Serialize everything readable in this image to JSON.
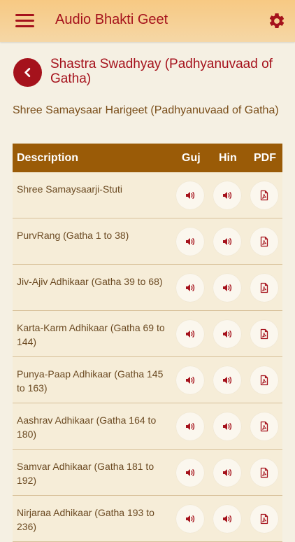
{
  "app": {
    "title": "Audio Bhakti Geet"
  },
  "page": {
    "title": "Shastra Swadhyay (Padhyanuvaad of Gatha)",
    "subtitle": "Shree Samaysaar Harigeet (Padhyanuvaad of Gatha)"
  },
  "table": {
    "headers": {
      "description": "Description",
      "guj": "Guj",
      "hin": "Hin",
      "pdf": "PDF"
    },
    "rows": [
      {
        "description": "Shree Samaysaarji-Stuti"
      },
      {
        "description": "PurvRang (Gatha 1 to 38)"
      },
      {
        "description": "Jiv-Ajiv Adhikaar (Gatha 39 to 68)"
      },
      {
        "description": "Karta-Karm Adhikaar (Gatha 69 to 144)"
      },
      {
        "description": "Punya-Paap Adhikaar (Gatha 145 to 163)"
      },
      {
        "description": "Aashrav Adhikaar (Gatha 164 to 180)"
      },
      {
        "description": "Samvar Adhikaar (Gatha 181 to 192)"
      },
      {
        "description": "Nirjaraa Adhikaar (Gatha 193 to 236)"
      }
    ]
  },
  "icons": {
    "menu": "menu-icon",
    "settings": "gear-icon",
    "back": "chevron-left-icon",
    "audio": "speaker-icon",
    "pdf": "pdf-file-icon"
  },
  "colors": {
    "brand_red": "#a5121c",
    "header_brown": "#9a5b07",
    "appbar_orange": "#f7c983",
    "background": "#f5f0e3",
    "row_bg": "#f6edd8"
  }
}
